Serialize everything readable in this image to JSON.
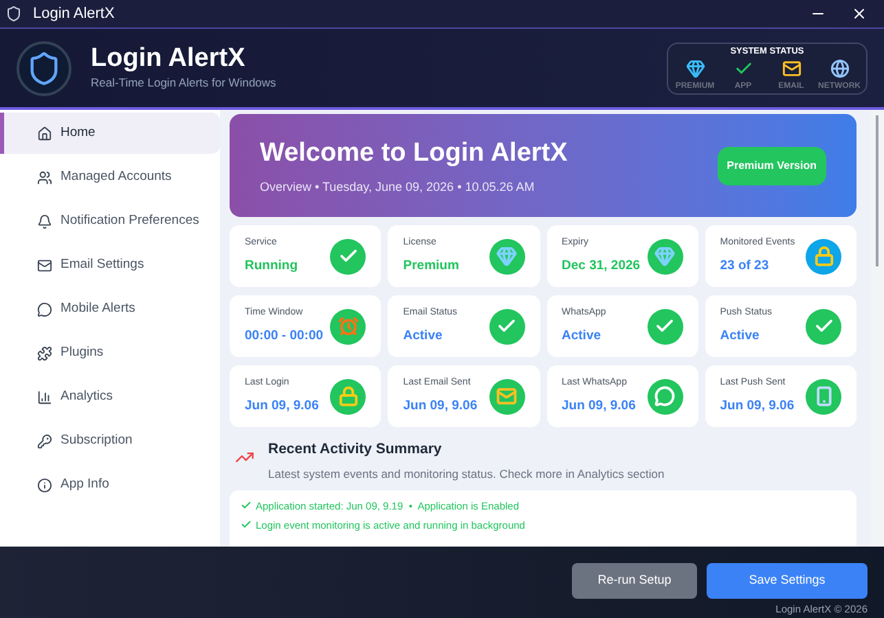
{
  "window": {
    "title": "Login AlertX"
  },
  "header": {
    "title": "Login AlertX",
    "subtitle": "Real-Time Login Alerts for Windows"
  },
  "system_status": {
    "title": "SYSTEM STATUS",
    "items": [
      "PREMIUM",
      "APP",
      "EMAIL",
      "NETWORK"
    ]
  },
  "sidebar": {
    "items": [
      {
        "label": "Home",
        "selected": true
      },
      {
        "label": "Managed Accounts",
        "selected": false
      },
      {
        "label": "Notification Preferences",
        "selected": false
      },
      {
        "label": "Email Settings",
        "selected": false
      },
      {
        "label": "Mobile Alerts",
        "selected": false
      },
      {
        "label": "Plugins",
        "selected": false
      },
      {
        "label": "Analytics",
        "selected": false
      },
      {
        "label": "Subscription",
        "selected": false
      },
      {
        "label": "App Info",
        "selected": false
      }
    ]
  },
  "banner": {
    "title": "Welcome to Login AlertX",
    "subtitle": "Overview • Tuesday, June 09, 2026 • 10.05.26 AM",
    "badge": "Premium Version"
  },
  "cards": [
    {
      "label": "Service",
      "value": "Running",
      "color": "#22c55e"
    },
    {
      "label": "License",
      "value": "Premium",
      "color": "#22c55e"
    },
    {
      "label": "Expiry",
      "value": "Dec 31, 2026",
      "color": "#22c55e"
    },
    {
      "label": "Monitored Events",
      "value": "23 of 23",
      "color": "#3b82f6"
    },
    {
      "label": "Time Window",
      "value": "00:00 - 00:00",
      "color": "#3b82f6"
    },
    {
      "label": "Email Status",
      "value": "Active",
      "color": "#3b82f6"
    },
    {
      "label": "WhatsApp",
      "value": "Active",
      "color": "#3b82f6"
    },
    {
      "label": "Push Status",
      "value": "Active",
      "color": "#3b82f6"
    },
    {
      "label": "Last Login",
      "value": "Jun 09, 9.06",
      "color": "#3b82f6"
    },
    {
      "label": "Last Email Sent",
      "value": "Jun 09, 9.06",
      "color": "#3b82f6"
    },
    {
      "label": "Last WhatsApp",
      "value": "Jun 09, 9.06",
      "color": "#3b82f6"
    },
    {
      "label": "Last Push Sent",
      "value": "Jun 09, 9.06",
      "color": "#3b82f6"
    }
  ],
  "activity": {
    "title": "Recent Activity Summary",
    "subtitle": "Latest system events and monitoring status. Check more in Analytics section",
    "items": [
      "Application started: Jun 09, 9.19  •  Application is Enabled",
      "Login event monitoring is active and running in background"
    ]
  },
  "buttons": [
    "Re-run Setup",
    "Save Settings"
  ],
  "footer": "Login AlertX © 2026"
}
